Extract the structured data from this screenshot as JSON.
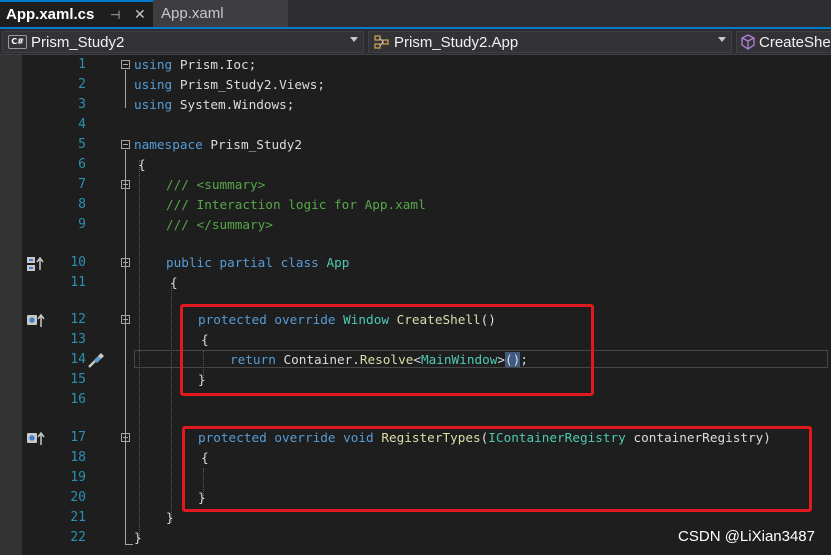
{
  "tabs": [
    {
      "label": "App.xaml.cs",
      "active": true,
      "pin_icon": "pin-icon",
      "close_icon": "close-icon"
    },
    {
      "label": "App.xaml",
      "active": false
    }
  ],
  "navbar": {
    "project": "Prism_Study2",
    "project_icon_text": "C#",
    "class": "Prism_Study2.App",
    "member": "CreateShe"
  },
  "editor": {
    "lines": [
      {
        "n": "1",
        "text": "using Prism.Ioc;"
      },
      {
        "n": "2",
        "text": "using Prism_Study2.Views;"
      },
      {
        "n": "3",
        "text": "using System.Windows;"
      },
      {
        "n": "4",
        "text": ""
      },
      {
        "n": "5",
        "text": "namespace Prism_Study2"
      },
      {
        "n": "6",
        "text": "{"
      },
      {
        "n": "7",
        "text": "/// <summary>"
      },
      {
        "n": "8",
        "text": "/// Interaction logic for App.xaml"
      },
      {
        "n": "9",
        "text": "/// </summary>"
      },
      {
        "n": "10",
        "text": "public partial class App"
      },
      {
        "n": "11",
        "text": "{"
      },
      {
        "n": "12",
        "text": "protected override Window CreateShell()"
      },
      {
        "n": "13",
        "text": "{"
      },
      {
        "n": "14",
        "text": "return Container.Resolve<MainWindow>();"
      },
      {
        "n": "15",
        "text": "}"
      },
      {
        "n": "16",
        "text": ""
      },
      {
        "n": "17",
        "text": "protected override void RegisterTypes(IContainerRegistry containerRegistry)"
      },
      {
        "n": "18",
        "text": "{"
      },
      {
        "n": "19",
        "text": ""
      },
      {
        "n": "20",
        "text": "}"
      },
      {
        "n": "21",
        "text": "}"
      },
      {
        "n": "22",
        "text": "}"
      }
    ],
    "tokens": {
      "l1": [
        "using",
        "Prism.Ioc;"
      ],
      "l2": [
        "using",
        "Prism_Study2.Views;"
      ],
      "l3": [
        "using",
        "System.Windows;"
      ],
      "l5": [
        "namespace",
        "Prism_Study2"
      ],
      "l7": [
        "/// <summary>"
      ],
      "l8": [
        "/// Interaction logic for App.xaml"
      ],
      "l9": [
        "/// </summary>"
      ],
      "l10": [
        "public",
        "partial",
        "class",
        "App"
      ],
      "l12": [
        "protected",
        "override",
        "Window",
        "CreateShell",
        "()"
      ],
      "l14": [
        "return",
        "Container.",
        "Resolve",
        "<",
        "MainWindow",
        ">",
        "()",
        ";"
      ],
      "l17": [
        "protected",
        "override",
        "void",
        "RegisterTypes",
        "(",
        "IContainerRegistry",
        "containerRegistry",
        ")"
      ]
    },
    "gutter_icons": {
      "l10": "derived-class-icon",
      "l12": "override-icon",
      "l14": "quick-action-screwdriver-icon",
      "l17": "override-icon"
    }
  },
  "watermark": "CSDN @LiXian3487",
  "colors": {
    "keyword": "#569cd6",
    "type": "#4ec9b0",
    "method": "#dcdcaa",
    "comment": "#57a64a",
    "line_number": "#2b91af",
    "highlight_box": "#e0191f",
    "active_tab_accent": "#007acc"
  }
}
